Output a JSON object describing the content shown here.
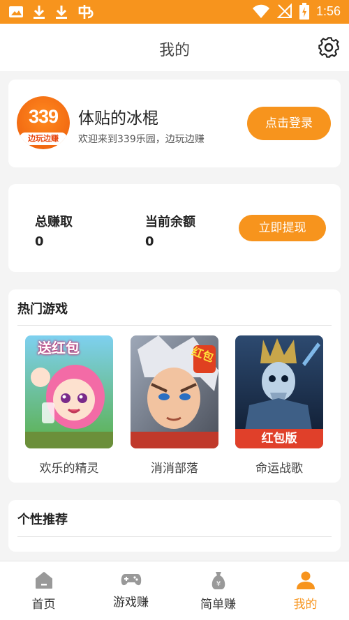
{
  "status_bar": {
    "time": "1:56",
    "left_icons": [
      "image-icon",
      "download-icon",
      "download-icon",
      "bug-icon"
    ],
    "right_icons": [
      "wifi-icon",
      "no-signal-icon",
      "battery-charging-icon"
    ],
    "background_color": "#f7941d"
  },
  "header": {
    "title": "我的",
    "settings_icon": "gear-icon"
  },
  "profile": {
    "logo_number": "339",
    "logo_tagline": "边玩边赚",
    "username": "体贴的冰棍",
    "welcome": "欢迎来到339乐园，边玩边赚",
    "login_button": "点击登录"
  },
  "earnings": {
    "total_label": "总赚取",
    "total_value": "0",
    "balance_label": "当前余额",
    "balance_value": "0",
    "withdraw_button": "立即提现"
  },
  "hot_games": {
    "title": "热门游戏",
    "games": [
      {
        "name": "欢乐的精灵",
        "banner": "送红包"
      },
      {
        "name": "消消部落",
        "banner": "红包"
      },
      {
        "name": "命运战歌",
        "banner": "红包版"
      }
    ]
  },
  "recommend": {
    "title": "个性推荐"
  },
  "tabbar": {
    "tabs": [
      {
        "label": "首页",
        "icon": "home-icon",
        "active": false
      },
      {
        "label": "游戏赚",
        "icon": "gamepad-icon",
        "active": false
      },
      {
        "label": "简单赚",
        "icon": "money-bag-icon",
        "active": false
      },
      {
        "label": "我的",
        "icon": "person-icon",
        "active": true
      }
    ],
    "active_color": "#f7941d",
    "inactive_color": "#999999"
  }
}
